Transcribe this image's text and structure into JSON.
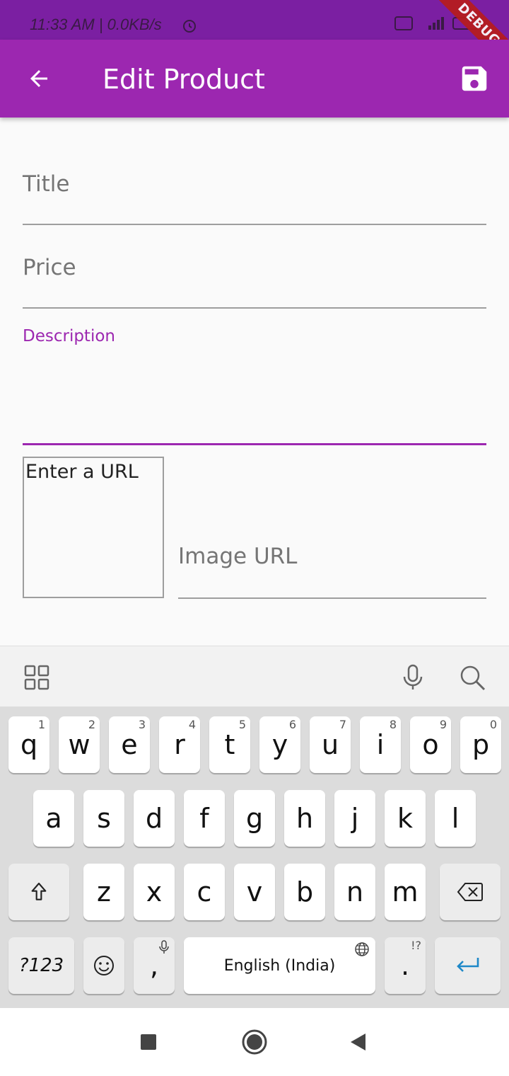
{
  "status_bar": {
    "time": "11:33 AM | 0.0KB/s",
    "debug_banner": "DEBUG"
  },
  "app_bar": {
    "title": "Edit Product",
    "back_icon": "arrow-left-icon",
    "save_icon": "save-icon"
  },
  "form": {
    "title_label": "Title",
    "price_label": "Price",
    "description_label": "Description",
    "image_preview_text": "Enter a URL",
    "image_url_label": "Image URL"
  },
  "keyboard": {
    "row1": [
      {
        "key": "q",
        "hint": "1"
      },
      {
        "key": "w",
        "hint": "2"
      },
      {
        "key": "e",
        "hint": "3"
      },
      {
        "key": "r",
        "hint": "4"
      },
      {
        "key": "t",
        "hint": "5"
      },
      {
        "key": "y",
        "hint": "6"
      },
      {
        "key": "u",
        "hint": "7"
      },
      {
        "key": "i",
        "hint": "8"
      },
      {
        "key": "o",
        "hint": "9"
      },
      {
        "key": "p",
        "hint": "0"
      }
    ],
    "row2": [
      "a",
      "s",
      "d",
      "f",
      "g",
      "h",
      "j",
      "k",
      "l"
    ],
    "row3": [
      "z",
      "x",
      "c",
      "v",
      "b",
      "n",
      "m"
    ],
    "symbols_label": "?123",
    "comma_label": ",",
    "space_label": "English (India)",
    "period_label": ".",
    "period_hint": "!?"
  },
  "colors": {
    "primary": "#9c27b0",
    "status_bar": "#7b1fa2",
    "accent_line": "#9c27b0"
  }
}
